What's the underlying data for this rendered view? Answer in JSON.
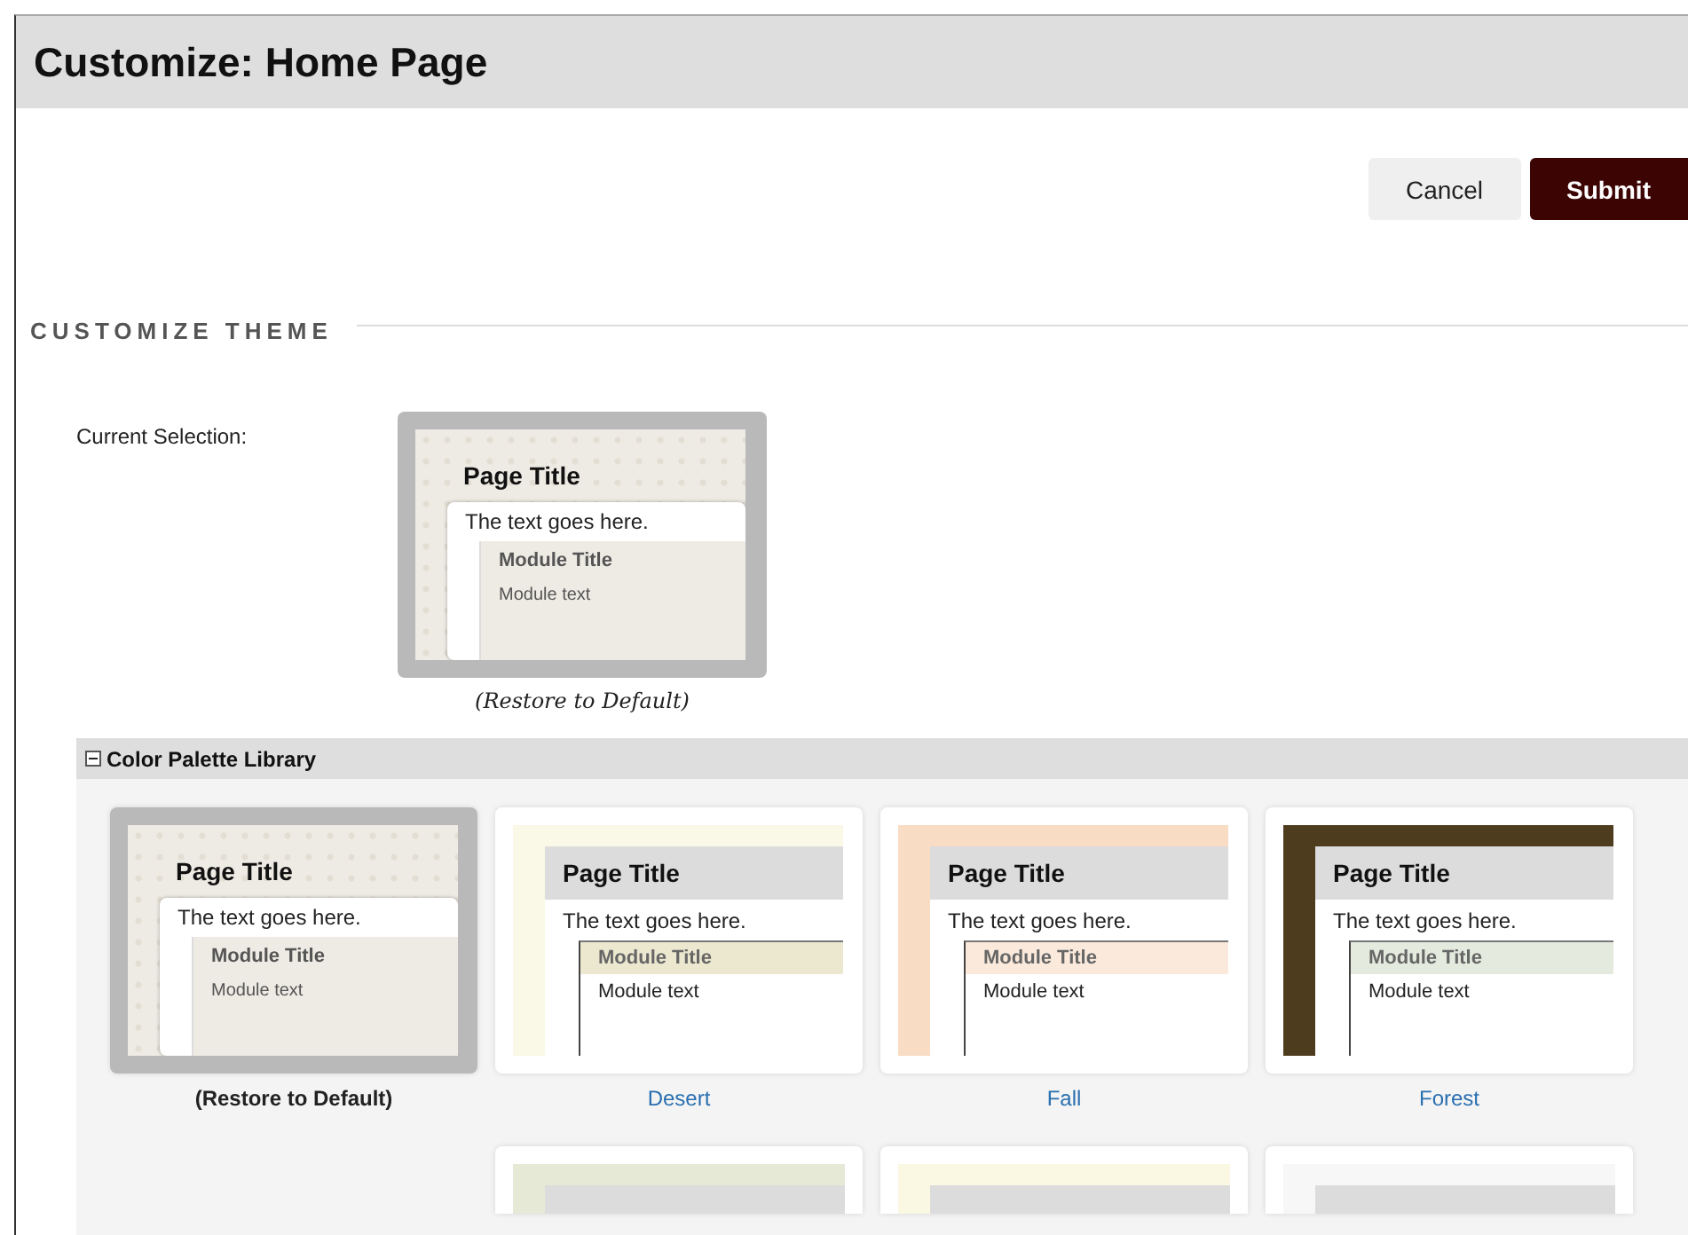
{
  "page": {
    "title": "Customize: Home Page"
  },
  "buttons": [
    {
      "label": "Cancel",
      "kind": "secondary"
    },
    {
      "label": "Submit",
      "kind": "primary"
    }
  ],
  "section": {
    "heading": "CUSTOMIZE THEME"
  },
  "current": {
    "label": "Current Selection:",
    "preview": {
      "kind": "default",
      "page_title": "Page Title",
      "text": "The text goes here.",
      "module_title": "Module Title",
      "module_text": "Module text"
    },
    "caption": "(Restore to Default)"
  },
  "library": {
    "title": "Color Palette Library",
    "expanded": true,
    "palettes": [
      {
        "name": "(Restore to Default)",
        "kind": "default",
        "selected": true,
        "page_title": "Page Title",
        "text": "The text goes here.",
        "module_title": "Module Title",
        "module_text": "Module text"
      },
      {
        "name": "Desert",
        "kind": "framed",
        "selected": false,
        "color": "#faf8e6",
        "module": {
          "color": "#ece8d0"
        },
        "page_title": "Page Title",
        "text": "The text goes here.",
        "module_title": "Module Title",
        "module_text": "Module text"
      },
      {
        "name": "Fall",
        "kind": "framed",
        "selected": false,
        "color": "#f8dcc4",
        "module": {
          "color": "#fbeadc"
        },
        "page_title": "Page Title",
        "text": "The text goes here.",
        "module_title": "Module Title",
        "module_text": "Module text"
      },
      {
        "name": "Forest",
        "kind": "framed",
        "selected": false,
        "color": "#4e3c1f",
        "module": {
          "color": "#e4eade"
        },
        "page_title": "Page Title",
        "text": "The text goes here.",
        "module_title": "Module Title",
        "module_text": "Module text"
      }
    ],
    "more_palettes": [
      {
        "kind": "framed",
        "color": "#e6e9d6"
      },
      {
        "kind": "framed",
        "color": "#faf7e2"
      },
      {
        "kind": "framed",
        "color": "#f7f7f7"
      }
    ]
  }
}
